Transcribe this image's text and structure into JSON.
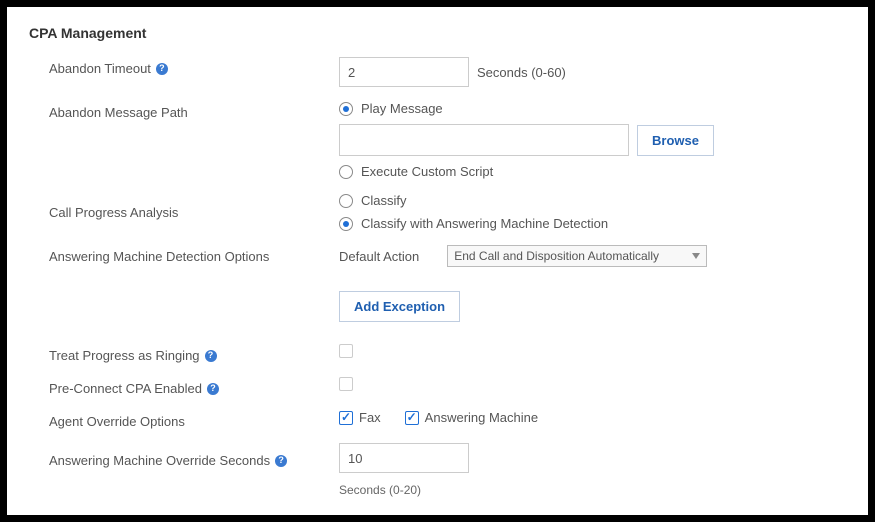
{
  "section_title": "CPA Management",
  "abandon_timeout": {
    "label": "Abandon Timeout",
    "value": "2",
    "hint": "Seconds (0-60)"
  },
  "abandon_message_path": {
    "label": "Abandon Message Path",
    "play_message_label": "Play Message",
    "path_value": "",
    "browse_label": "Browse",
    "execute_script_label": "Execute Custom Script"
  },
  "call_progress": {
    "label": "Call Progress Analysis",
    "classify_label": "Classify",
    "classify_amd_label": "Classify with Answering Machine Detection"
  },
  "amd_options": {
    "label": "Answering Machine Detection Options",
    "default_action_label": "Default Action",
    "default_action_value": "End Call and Disposition Automatically",
    "add_exception_label": "Add Exception"
  },
  "treat_progress": {
    "label": "Treat Progress as Ringing"
  },
  "pre_connect": {
    "label": "Pre-Connect CPA Enabled"
  },
  "agent_override": {
    "label": "Agent Override Options",
    "fax_label": "Fax",
    "am_label": "Answering Machine"
  },
  "amd_override_seconds": {
    "label": "Answering Machine Override Seconds",
    "value": "10",
    "hint": "Seconds (0-20)"
  }
}
